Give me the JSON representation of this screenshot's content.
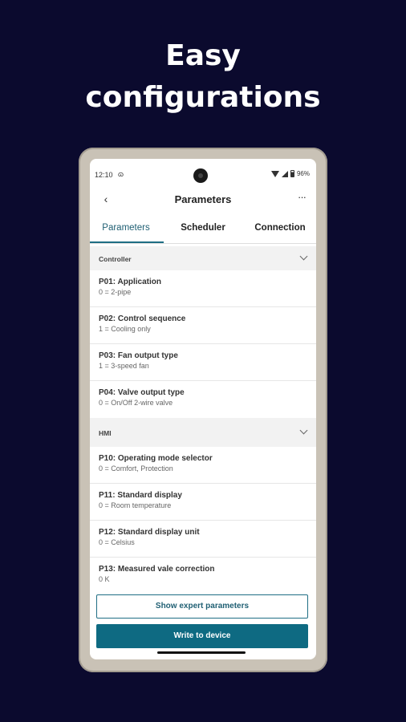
{
  "headline": {
    "line1": "Easy",
    "line2": "configurations"
  },
  "status_bar": {
    "time": "12:10",
    "notification": "ɷ",
    "battery": "96%"
  },
  "app_bar": {
    "back_icon": "‹",
    "title": "Parameters",
    "more_icon": "···"
  },
  "tabs": [
    {
      "label": "Parameters",
      "selected": true
    },
    {
      "label": "Scheduler",
      "selected": false
    },
    {
      "label": "Connection",
      "selected": false
    }
  ],
  "sections": [
    {
      "header": "Controller",
      "params": [
        {
          "title": "P01: Application",
          "value": "0 = 2-pipe"
        },
        {
          "title": "P02: Control sequence",
          "value": "1 = Cooling only"
        },
        {
          "title": "P03: Fan output type",
          "value": "1 = 3-speed fan"
        },
        {
          "title": "P04: Valve output type",
          "value": "0 = On/Off 2-wire valve"
        }
      ]
    },
    {
      "header": "HMI",
      "params": [
        {
          "title": "P10: Operating mode selector",
          "value": "0 = Comfort, Protection"
        },
        {
          "title": "P11: Standard display",
          "value": "0 = Room temperature"
        },
        {
          "title": "P12: Standard display unit",
          "value": "0 = Celsius"
        },
        {
          "title": "P13: Measured vale correction",
          "value": "0 K"
        }
      ]
    }
  ],
  "buttons": {
    "expert": "Show expert parameters",
    "write": "Write to device"
  },
  "colors": {
    "background": "#0b0a2e",
    "accent": "#0e6a82",
    "frame": "#c9c2b6"
  }
}
